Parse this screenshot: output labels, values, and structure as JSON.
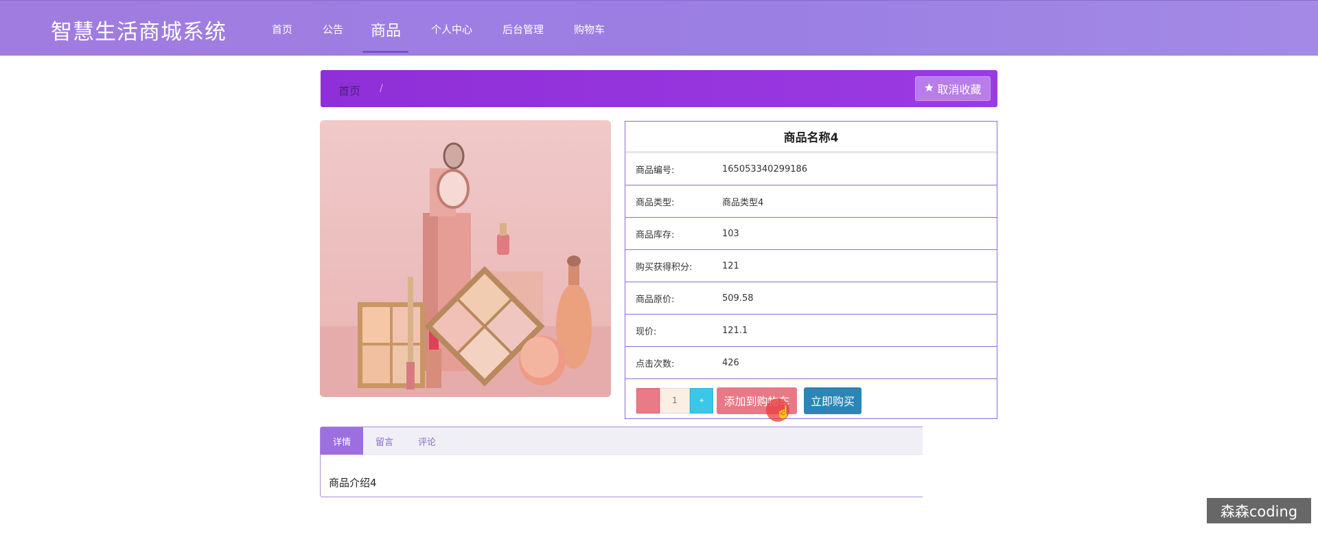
{
  "app": {
    "brand": "智慧生活商城系统"
  },
  "nav": {
    "items": [
      {
        "label": "首页"
      },
      {
        "label": "公告"
      },
      {
        "label": "商品",
        "active": true
      },
      {
        "label": "个人中心"
      },
      {
        "label": "后台管理"
      },
      {
        "label": "购物车"
      }
    ]
  },
  "breadcrumb": {
    "home": "首页",
    "separator": "/",
    "favorite_label": "取消收藏",
    "favorite_icon": "star-icon"
  },
  "product": {
    "image_icon": "cosmetics-image",
    "title": "商品名称4",
    "fields": [
      {
        "label": "商品编号:",
        "value": "165053340299186"
      },
      {
        "label": "商品类型:",
        "value": "商品类型4"
      },
      {
        "label": "商品库存:",
        "value": "103"
      },
      {
        "label": "购买获得积分:",
        "value": "121"
      },
      {
        "label": "商品原价:",
        "value": "509.58"
      },
      {
        "label": "现价:",
        "value": "121.1"
      },
      {
        "label": "点击次数:",
        "value": "426"
      }
    ],
    "quantity": "1",
    "qty_plus": "+",
    "add_to_cart_label": "添加到购物车",
    "buy_now_label": "立即购买"
  },
  "tabs": {
    "items": [
      {
        "label": "详情",
        "active": true
      },
      {
        "label": "留言"
      },
      {
        "label": "评论"
      }
    ],
    "content": "商品介绍4"
  },
  "watermark": "森森coding",
  "colors": {
    "nav_bg": "#a17ce0",
    "crumb_bg": "#8f2fd8",
    "cart_btn": "#e97886",
    "buy_btn": "#2b86b5",
    "plus_btn": "#3cc7e8",
    "tab_active": "#9c6fe0"
  }
}
